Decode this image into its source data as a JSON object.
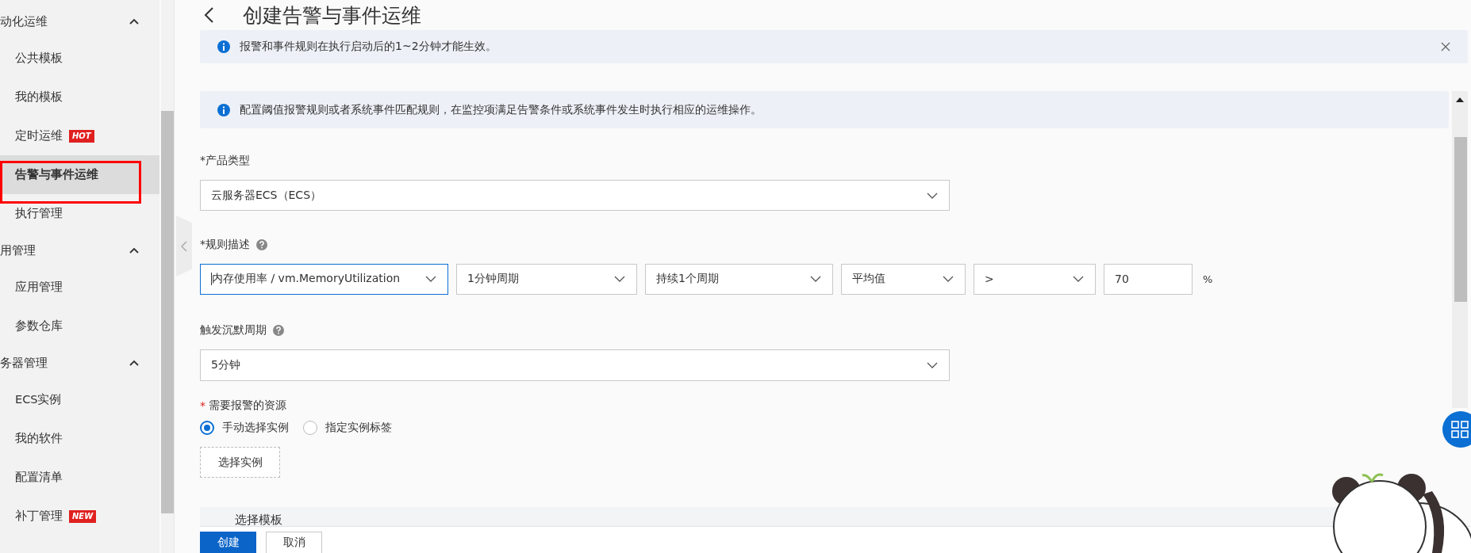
{
  "sidebar": {
    "groups": [
      {
        "label": "动化运维",
        "expanded": true,
        "items": [
          {
            "label": "公共模板",
            "selected": false
          },
          {
            "label": "我的模板",
            "selected": false
          },
          {
            "label": "定时运维",
            "selected": false,
            "badge": "HOT"
          },
          {
            "label": "告警与事件运维",
            "selected": true
          },
          {
            "label": "执行管理",
            "selected": false
          }
        ]
      },
      {
        "label": "用管理",
        "expanded": true,
        "items": [
          {
            "label": "应用管理",
            "selected": false
          },
          {
            "label": "参数仓库",
            "selected": false
          }
        ]
      },
      {
        "label": "务器管理",
        "expanded": true,
        "items": [
          {
            "label": "ECS实例",
            "selected": false
          },
          {
            "label": "我的软件",
            "selected": false
          },
          {
            "label": "配置清单",
            "selected": false
          },
          {
            "label": "补丁管理",
            "selected": false,
            "badge": "NEW"
          }
        ]
      }
    ]
  },
  "page_title": "创建告警与事件运维",
  "notices": [
    {
      "text": "报警和事件规则在执行启动后的1~2分钟才能生效。",
      "closable": true
    },
    {
      "text": "配置阈值报警规则或者系统事件匹配规则，在监控项满足告警条件或系统事件发生时执行相应的运维操作。",
      "closable": false
    }
  ],
  "form": {
    "product_type": {
      "label": "*产品类型",
      "value": "云服务器ECS（ECS）"
    },
    "rule": {
      "label": "*规则描述",
      "help": true,
      "unit": "%",
      "fields": [
        {
          "kind": "select",
          "value": "内存使用率 / vm.MemoryUtilization",
          "focused": true
        },
        {
          "kind": "select",
          "value": "1分钟周期",
          "focused": false
        },
        {
          "kind": "select",
          "value": "持续1个周期",
          "focused": false
        },
        {
          "kind": "select",
          "value": "平均值",
          "focused": false
        },
        {
          "kind": "select",
          "value": ">",
          "focused": false
        },
        {
          "kind": "input",
          "value": "70",
          "focused": false
        }
      ]
    },
    "silence": {
      "label": "触发沉默周期",
      "help": true,
      "value": "5分钟"
    },
    "resources": {
      "required_mark": "*",
      "label": "需要报警的资源",
      "options": [
        {
          "label": "手动选择实例",
          "selected": true
        },
        {
          "label": "指定实例标签",
          "selected": false
        }
      ],
      "button": "选择实例"
    },
    "template_section": {
      "title": "选择模板"
    }
  },
  "actions": [
    {
      "label": "创建",
      "kind": "primary"
    },
    {
      "label": "取消",
      "kind": "default"
    }
  ]
}
